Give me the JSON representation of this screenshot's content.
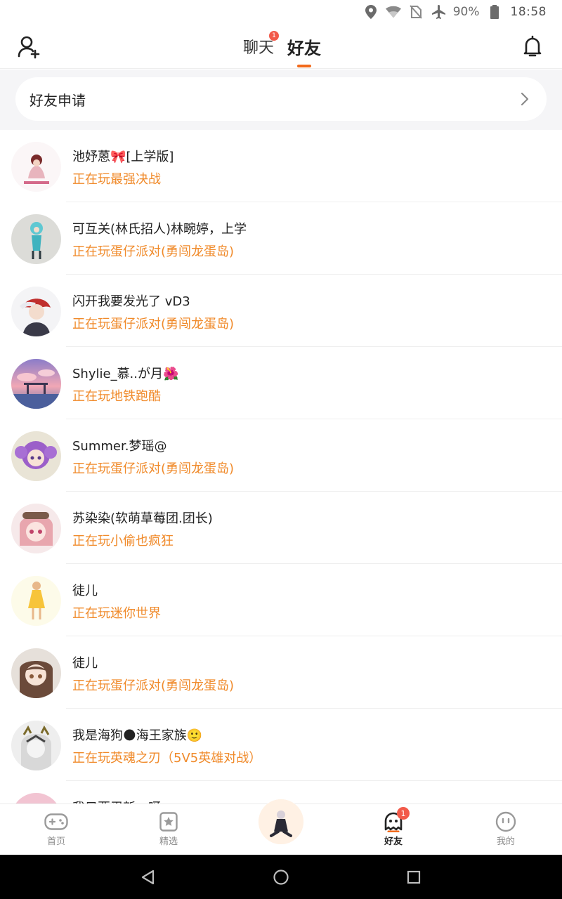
{
  "status_bar": {
    "battery": "90%",
    "time": "18:58",
    "icons": [
      "location-icon",
      "wifi-icon",
      "no-sim-icon",
      "airplane-icon",
      "battery-icon"
    ]
  },
  "top_nav": {
    "tabs": [
      {
        "label": "聊天",
        "badge": "1"
      },
      {
        "label": "好友",
        "active": true
      }
    ],
    "icons": [
      "add-friend-icon",
      "bell-icon"
    ]
  },
  "friend_request": {
    "label": "好友申请"
  },
  "friends": [
    {
      "name": "池妤蒽🎀[上学版]",
      "status": "正在玩最强决战"
    },
    {
      "name": "可互关(林氏招人)林畹婷，上学",
      "status": "正在玩蛋仔派对(勇闯龙蛋岛)"
    },
    {
      "name": "闪开我要发光了 vD3",
      "status": "正在玩蛋仔派对(勇闯龙蛋岛)"
    },
    {
      "name": "Shylie_慕..が月🌺",
      "status": "正在玩地铁跑酷"
    },
    {
      "name": "Summer.梦瑶@",
      "status": "正在玩蛋仔派对(勇闯龙蛋岛)"
    },
    {
      "name": "苏染染(软萌草莓团.团长)",
      "status": "正在玩小偷也疯狂"
    },
    {
      "name": "徒儿",
      "status": "正在玩迷你世界"
    },
    {
      "name": "徒儿",
      "status": "正在玩蛋仔派对(勇闯龙蛋岛)"
    },
    {
      "name": "我是海狗🌑海王家族🙂",
      "status": "正在玩英魂之刃（5V5英雄对战）"
    },
    {
      "name": "我只要忍新一呀",
      "status": ""
    }
  ],
  "bottom_tabs": [
    {
      "label": "首页",
      "icon": "gamepad-icon"
    },
    {
      "label": "精选",
      "icon": "star-card-icon"
    },
    {
      "label": "",
      "icon": "center-avatar"
    },
    {
      "label": "好友",
      "icon": "ghost-icon",
      "badge": "1",
      "active": true
    },
    {
      "label": "我的",
      "icon": "face-icon"
    }
  ],
  "colors": {
    "accent": "#f26a1b",
    "status_text": "#f08a2a",
    "badge": "#f25a4a"
  }
}
